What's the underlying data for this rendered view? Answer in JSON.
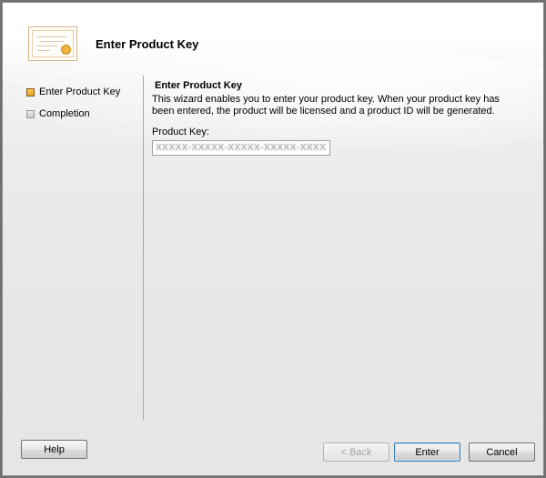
{
  "header": {
    "title": "Enter Product Key",
    "icon": "certificate-icon"
  },
  "nav": {
    "items": [
      {
        "label": "Enter Product Key",
        "state": "active"
      },
      {
        "label": "Completion",
        "state": "pending"
      }
    ]
  },
  "content": {
    "title": "Enter Product Key",
    "description": "This wizard enables you to enter your product key. When your product key has been entered, the product will be licensed and a product ID will be generated.",
    "product_key_label": "Product Key:",
    "product_key_value": "XXXXX-XXXXX-XXXXX-XXXXX-XXXXX"
  },
  "buttons": {
    "help": "Help",
    "back": "< Back",
    "enter": "Enter",
    "cancel": "Cancel"
  },
  "colors": {
    "active_step": "#e6a323",
    "pending_step": "#c9c9c9"
  }
}
